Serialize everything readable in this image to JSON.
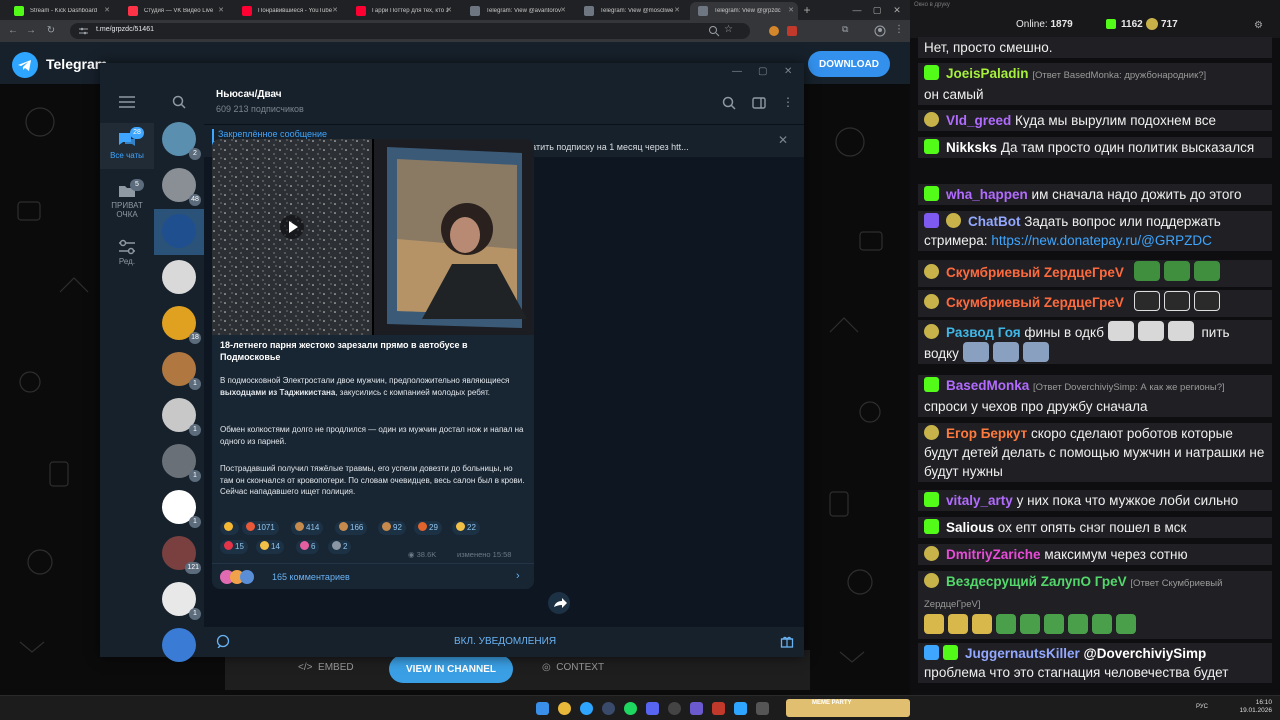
{
  "browser": {
    "tabs": [
      {
        "title": "Stream - Kick Dashboard",
        "color": "#53fc18"
      },
      {
        "title": "Студия — VK Видео Live",
        "color": "#ff3347"
      },
      {
        "title": "Понравившиеся - YouTube",
        "color": "#ff0033"
      },
      {
        "title": "Гарри Поттер для тех, кто з",
        "color": "#ff0033"
      },
      {
        "title": "Telegram: View @avantorov",
        "color": "#6e7681"
      },
      {
        "title": "Telegram: View @moscliwe",
        "color": "#6e7681"
      },
      {
        "title": "Telegram: View @grpzdc",
        "color": "#6e7681"
      }
    ],
    "url": "t.me/grpzdc/51461"
  },
  "tg_web": {
    "brand": "Telegram",
    "download": "DOWNLOAD",
    "embed": "EMBED",
    "view_in_channel": "VIEW IN CHANNEL",
    "context": "CONTEXT"
  },
  "tg_app": {
    "folders": [
      {
        "label": "Все чаты",
        "badge": "28"
      },
      {
        "label": "ПРИВАТ ОЧКА",
        "badge": "5"
      },
      {
        "label": "Ред.",
        "badge": ""
      }
    ],
    "chats": [
      {
        "badge": "2",
        "color": "#5a8fb0"
      },
      {
        "badge": "48",
        "color": "#8a8f95"
      },
      {
        "badge": "",
        "color": "#1f4f8f"
      },
      {
        "badge": "",
        "color": "#d9d9d9"
      },
      {
        "badge": "18",
        "color": "#e0a020"
      },
      {
        "badge": "1",
        "color": "#b07840"
      },
      {
        "badge": "1",
        "color": "#c8c8c8"
      },
      {
        "badge": "1",
        "color": "#6a7078"
      },
      {
        "badge": "1",
        "color": "#ffffff"
      },
      {
        "badge": "121",
        "color": "#7a4040"
      },
      {
        "badge": "1",
        "color": "#e8e8e8"
      },
      {
        "badge": "",
        "color": "#3a7bd5"
      }
    ],
    "channel": {
      "title": "Ньюсач/Двач",
      "subscribers": "609 213 подписчиков"
    },
    "pinned": {
      "title": "Закреплённое сообщение",
      "text": "‼️ Прислать новость: @ru2chnews_bot ⚡ Как разбаниться в Ньюсаче:   Оплатить подписку на 1 месяц через htt..."
    },
    "message": {
      "title": "18-летнего парня жестоко зарезали прямо в автобусе в Подмосковье",
      "p1_a": "В подмосковной Электростали двое мужчин, предположительно являющиеся ",
      "p1_b": "выходцами из Таджикистана",
      "p1_c": ", закусились с компанией молодых ребят.",
      "p2": "Обмен колкостями долго не продлился — один из мужчин достал нож и напал на одного из парней.",
      "p3": "Пострадавший получил тяжёлые травмы, его успели довезти до больницы, но там он скончался от кровопотери. По словам очевидцев, весь салон был в крови. Сейчас нападавшего ищет полиция.",
      "reactions_row1": [
        {
          "count": "",
          "color": "#f5b833"
        },
        {
          "count": "1071",
          "color": "#e8593a"
        },
        {
          "count": "414",
          "color": "#c68a4c"
        },
        {
          "count": "166",
          "color": "#c68a4c"
        },
        {
          "count": "92",
          "color": "#c68a4c"
        },
        {
          "count": "29",
          "color": "#e0642c"
        },
        {
          "count": "22",
          "color": "#f2c046"
        }
      ],
      "reactions_row2": [
        {
          "count": "15",
          "color": "#e3344a"
        },
        {
          "count": "14",
          "color": "#f2c046"
        },
        {
          "count": "6",
          "color": "#e45fa0"
        },
        {
          "count": "2",
          "color": "#8a96a3"
        }
      ],
      "views": "38.6K",
      "edited": "изменено 15:58",
      "comments": "165 комментариев"
    },
    "unmute": "ВКЛ. УВЕДОМЛЕНИЯ"
  },
  "stream_chat": {
    "window_title": "Окно в друку",
    "online_label": "Online:",
    "online": "1879",
    "count1": "1162",
    "count2": "717",
    "messages": [
      {
        "text": "Нет, просто смешно."
      },
      {
        "user": "JoeisPaladin",
        "reply": "[Ответ BasedMonka: дружбонародник?]",
        "text": "он самый",
        "color": "#a6f03c"
      },
      {
        "user": "Vld_greed",
        "text": "Куда мы вырулим подохнем все",
        "color": "#b26bff"
      },
      {
        "user": "Nikksks",
        "text": "Да там просто один политик высказался",
        "color": "#ffffff"
      },
      {
        "user": "wha_happen",
        "text": "им сначала надо дожить до этого",
        "color": "#b26bff"
      },
      {
        "user": "ChatBot",
        "text": "Задать вопрос или поддержать стримера:",
        "link": "https://new.donatepay.ru/@GRPZDC",
        "color": "#93a8ff"
      },
      {
        "user": "Скумбриевый ZердцеГреV",
        "color": "#ff6a3d"
      },
      {
        "user": "Скумбриевый ZердцеГреV",
        "color": "#ff6a3d"
      },
      {
        "user": "Развод Гоя",
        "text": "фины в одкб",
        "text2": "пить водку",
        "color": "#3fb8e8"
      },
      {
        "user": "BasedMonka",
        "reply": "[Ответ DoverchiviySimp: А как же регионы?]",
        "text": "спроси у чехов про дружбу сначала",
        "color": "#b26bff"
      },
      {
        "user": "Егор Беркут",
        "text": "скоро сделают роботов которые будут детей делать с помощью мужчин и натрашки не будут нужны",
        "color": "#ff7a3d"
      },
      {
        "user": "vitaly_arty",
        "text": "у них пока что мужкое лоби сильно",
        "color": "#b26bff"
      },
      {
        "user": "Salious",
        "text": "ох епт опять снэг пошел в мск",
        "color": "#ffffff"
      },
      {
        "user": "DmitriyZariche",
        "text": "максимум через сотню",
        "color": "#e84bd8"
      },
      {
        "user": "Вездесрущий ZалупО ГреV",
        "reply": "[Ответ Скумбриевый ZердцеГреV]",
        "color": "#53d96b"
      },
      {
        "user": "JuggernautsKiller",
        "mention": "@DoverchiviySimp",
        "text": "проблема что это стагнация человечества будет",
        "color": "#93a8ff"
      }
    ]
  },
  "taskbar": {
    "lang": "РУС",
    "time": "16:10",
    "date": "19.01.2026",
    "widget": "MEME PARTY"
  }
}
